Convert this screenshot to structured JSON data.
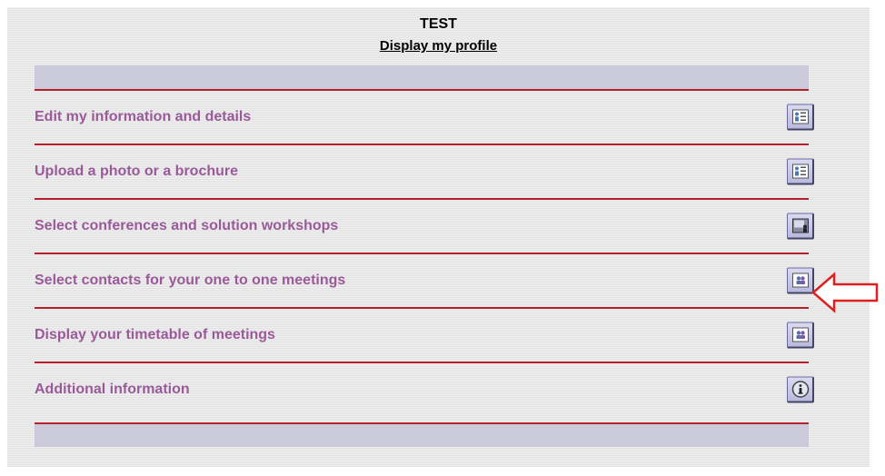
{
  "header": {
    "title": "TEST",
    "profile_link": "Display my profile"
  },
  "menu": {
    "items": [
      {
        "label": "Edit my information and details",
        "icon": "id-card-icon"
      },
      {
        "label": "Upload a photo or a brochure",
        "icon": "id-card-icon"
      },
      {
        "label": "Select conferences and solution workshops",
        "icon": "presentation-icon"
      },
      {
        "label": "Select contacts for your one to one meetings",
        "icon": "contacts-icon"
      },
      {
        "label": "Display your timetable of meetings",
        "icon": "contacts-icon"
      },
      {
        "label": "Additional information",
        "icon": "info-icon"
      }
    ]
  },
  "annotation": {
    "icon": "red-arrow-left-icon",
    "color": "#e02020"
  },
  "colors": {
    "accent_line": "#b51f2e",
    "label": "#9a5a9a",
    "bar": "#cacadb"
  }
}
